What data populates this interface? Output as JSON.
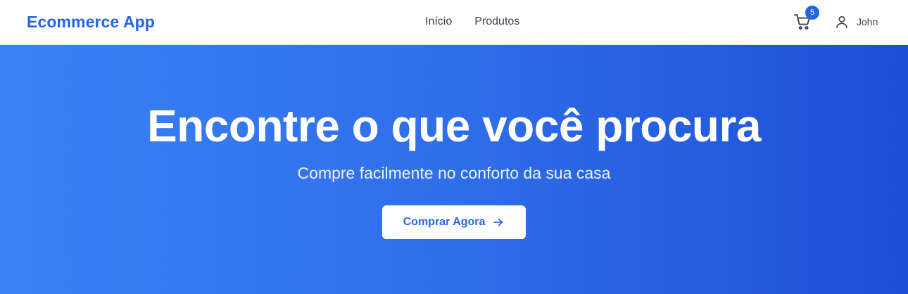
{
  "navbar": {
    "brand": "Ecommerce App",
    "links": [
      {
        "label": "Início"
      },
      {
        "label": "Produtos"
      }
    ],
    "cart": {
      "icon": "shopping-cart-icon",
      "count": "5"
    },
    "user": {
      "icon": "user-icon",
      "name": "John"
    }
  },
  "hero": {
    "title": "Encontre o que você procura",
    "subtitle": "Compre facilmente no conforto da sua casa",
    "cta_label": "Comprar Agora",
    "cta_icon": "arrow-right-icon"
  },
  "colors": {
    "brand": "#2563eb",
    "hero_gradient_start": "#3b82f6",
    "hero_gradient_end": "#1d4ed8",
    "text_dark": "#374151"
  }
}
